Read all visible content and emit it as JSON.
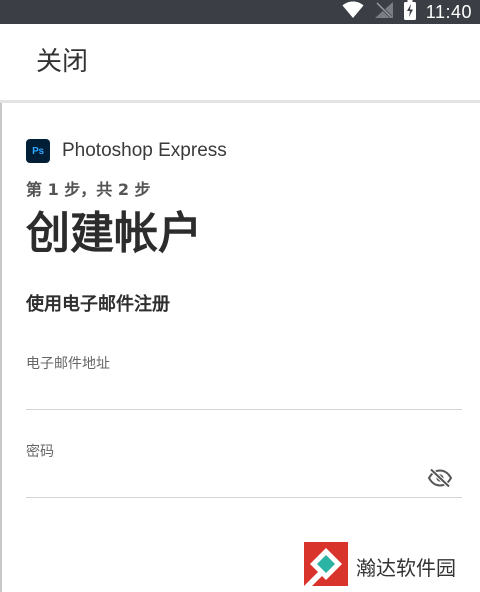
{
  "status_bar": {
    "time": "11:40",
    "icons": [
      "wifi-icon",
      "signal-off-icon",
      "battery-charging-icon"
    ]
  },
  "top_bar": {
    "close_label": "关闭"
  },
  "brand": {
    "logo_text": "Ps",
    "name": "Photoshop Express"
  },
  "form": {
    "step_text": "第 1 步，共 2 步",
    "title": "创建帐户",
    "section_heading": "使用电子邮件注册",
    "email": {
      "label": "电子邮件地址",
      "value": ""
    },
    "password": {
      "label": "密码",
      "value": "",
      "toggle_icon": "eye-off-icon"
    }
  },
  "watermark": {
    "text": "瀚达软件园"
  },
  "colors": {
    "status_bar": "#3b3f45",
    "ps_logo_bg": "#001e36",
    "ps_logo_text": "#31a8ff",
    "watermark_red": "#d9342b",
    "watermark_teal": "#2bb3a3"
  }
}
